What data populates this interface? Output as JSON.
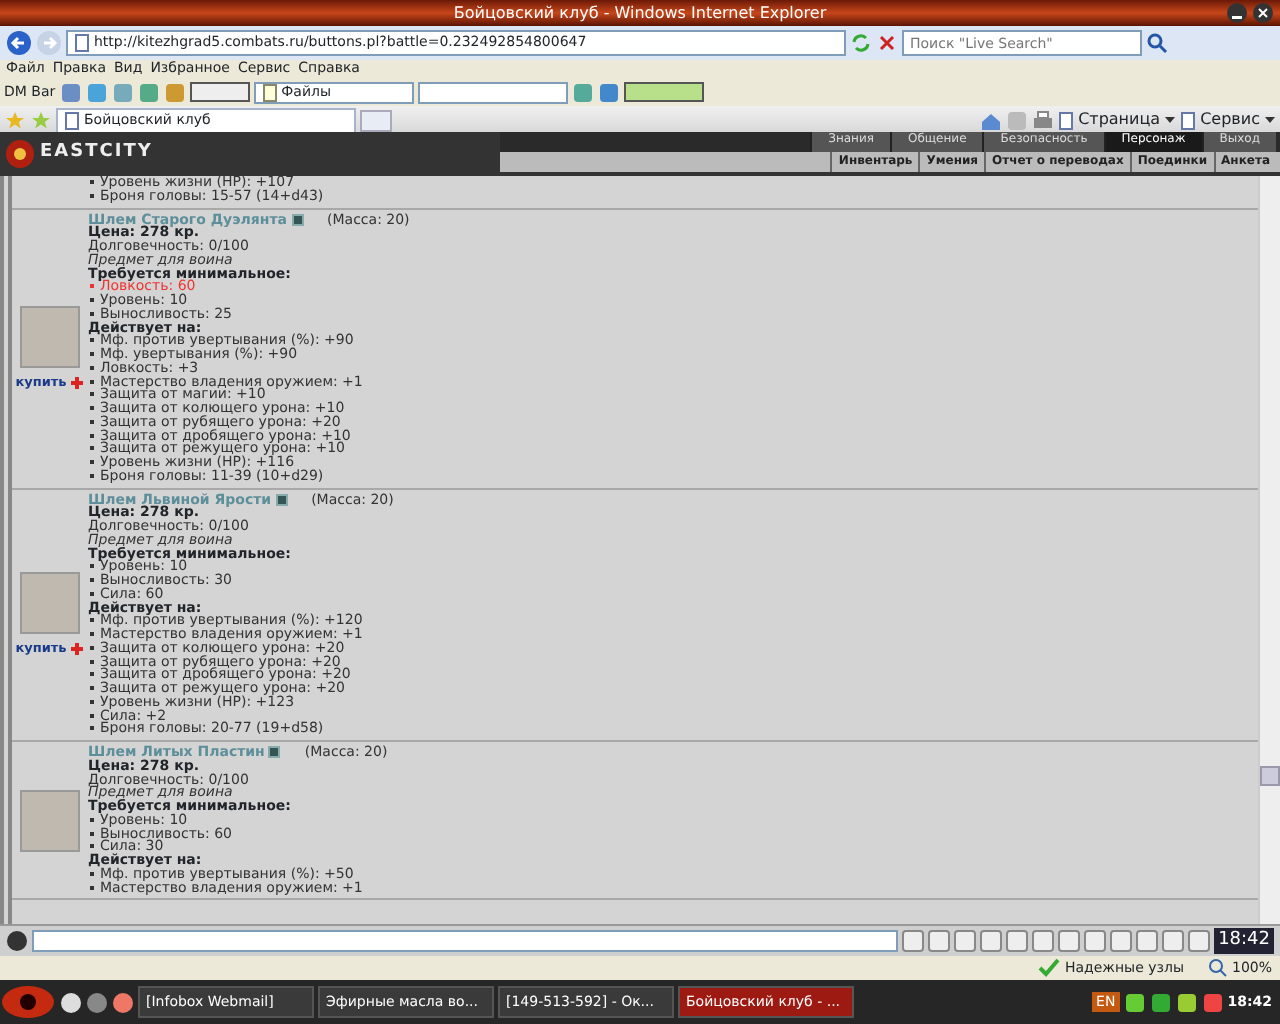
{
  "window": {
    "title": "Бойцовский клуб - Windows Internet Explorer"
  },
  "address_bar": {
    "url": "http://kitezhgrad5.combats.ru/buttons.pl?battle=0.232492854800647",
    "search_placeholder": "Поиск \"Live Search\""
  },
  "menu": [
    "Файл",
    "Правка",
    "Вид",
    "Избранное",
    "Сервис",
    "Справка"
  ],
  "dm_bar": {
    "label": "DM Bar",
    "dropdown": "Файлы"
  },
  "tab": {
    "title": "Бойцовский клуб"
  },
  "command_bar": [
    "Страница",
    "Сервис"
  ],
  "game": {
    "logo": "EASTCITY",
    "menu": [
      {
        "label": "Знания",
        "selected": false
      },
      {
        "label": "Общение",
        "selected": false
      },
      {
        "label": "Безопасность",
        "selected": false
      },
      {
        "label": "Персонаж",
        "selected": true
      },
      {
        "label": "Выход",
        "selected": false
      }
    ],
    "submenu": [
      "Инвентарь",
      "Умения",
      "Отчет о переводах",
      "Поединки",
      "Анкета"
    ]
  },
  "partial_item": {
    "effects": [
      "Уровень жизни (HP): +107",
      "Броня головы: 15-57 (14+d43)"
    ]
  },
  "items": [
    {
      "name": "Шлем Старого Дуэлянта",
      "mass": "(Масса: 20)",
      "price": "Цена: 278 кр.",
      "durability": "Долговечность: 0/100",
      "note": "Предмет для воина",
      "requirements_title": "Требуется минимальное:",
      "requirements": [
        {
          "text": "Ловкость: 60",
          "met": false
        },
        {
          "text": "Уровень: 10",
          "met": true
        },
        {
          "text": "Выносливость: 25",
          "met": true
        }
      ],
      "effects_title": "Действует на:",
      "effects": [
        "Мф. против увертывания (%): +90",
        "Мф. увертывания (%): +90",
        "Ловкость: +3",
        "Мастерство владения оружием: +1",
        "Защита от магии: +10",
        "Защита от колющего урона: +10",
        "Защита от рубящего урона: +20",
        "Защита от дробящего урона: +10",
        "Защита от режущего урона: +10",
        "Уровень жизни (HP): +116",
        "Броня головы: 11-39 (10+d29)"
      ],
      "buy": "купить"
    },
    {
      "name": "Шлем Львиной Ярости",
      "mass": "(Масса: 20)",
      "price": "Цена: 278 кр.",
      "durability": "Долговечность: 0/100",
      "note": "Предмет для воина",
      "requirements_title": "Требуется минимальное:",
      "requirements": [
        {
          "text": "Уровень: 10",
          "met": true
        },
        {
          "text": "Выносливость: 30",
          "met": true
        },
        {
          "text": "Сила: 60",
          "met": true
        }
      ],
      "effects_title": "Действует на:",
      "effects": [
        "Мф. против увертывания (%): +120",
        "Мастерство владения оружием: +1",
        "Защита от колющего урона: +20",
        "Защита от рубящего урона: +20",
        "Защита от дробящего урона: +20",
        "Защита от режущего урона: +20",
        "Уровень жизни (HP): +123",
        "Сила: +2",
        "Броня головы: 20-77 (19+d58)"
      ],
      "buy": "купить"
    },
    {
      "name": "Шлем Литых Пластин",
      "mass": "(Масса: 20)",
      "price": "Цена: 278 кр.",
      "durability": "Долговечность: 0/100",
      "note": "Предмет для воина",
      "requirements_title": "Требуется минимальное:",
      "requirements": [
        {
          "text": "Уровень: 10",
          "met": true
        },
        {
          "text": "Выносливость: 60",
          "met": true
        },
        {
          "text": "Сила: 30",
          "met": true
        }
      ],
      "effects_title": "Действует на:",
      "effects": [
        "Мф. против увертывания (%): +50",
        "Мастерство владения оружием: +1"
      ]
    }
  ],
  "chat": {
    "time": "18:42"
  },
  "status_bar": {
    "zone": "Надежные узлы",
    "zoom": "100%"
  },
  "taskbar": {
    "tasks": [
      {
        "label": "[Infobox Webmail]",
        "selected": false
      },
      {
        "label": "Эфирные масла во...",
        "selected": false
      },
      {
        "label": "[149-513-592] - Ок...",
        "selected": false
      },
      {
        "label": "Бойцовский клуб - ...",
        "selected": true
      }
    ],
    "language": "EN",
    "time": "18:42"
  }
}
